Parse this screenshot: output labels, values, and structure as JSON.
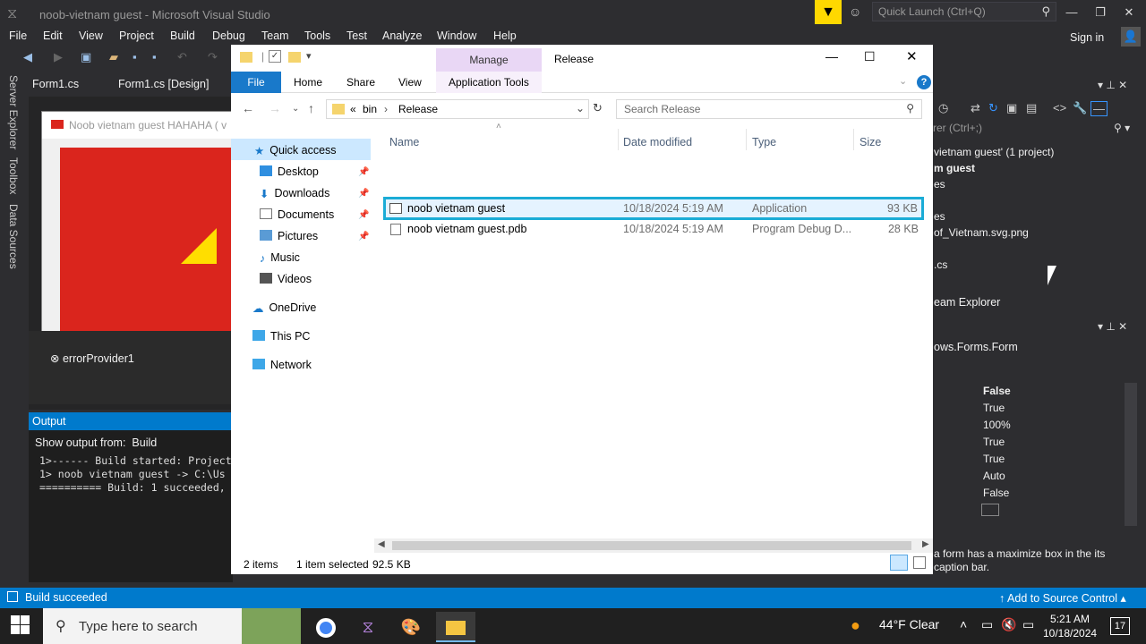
{
  "vs": {
    "title": "noob-vietnam guest - Microsoft Visual Studio",
    "quick_launch_placeholder": "Quick Launch (Ctrl+Q)",
    "menu": [
      "File",
      "Edit",
      "View",
      "Project",
      "Build",
      "Debug",
      "Team",
      "Tools",
      "Test",
      "Analyze",
      "Window",
      "Help"
    ],
    "sign_in": "Sign in",
    "side_tabs": [
      "Server Explorer",
      "Toolbox",
      "Data Sources"
    ],
    "doc_tabs": [
      "Form1.cs",
      "Form1.cs [Design]"
    ],
    "form_title": "Noob vietnam guest HAHAHA ( v",
    "component_tray_item": "errorProvider1",
    "output": {
      "header": "Output",
      "show_from_label": "Show output from:",
      "show_from_value": "Build",
      "lines": [
        "1>------ Build started: Project",
        "1>  noob vietnam guest -> C:\\Us",
        "========== Build: 1 succeeded,"
      ]
    },
    "solution_explorer": {
      "search_placeholder": "rer (Ctrl+;)",
      "lines": [
        "vietnam guest' (1 project)",
        "m guest",
        "es",
        "es",
        "of_Vietnam.svg.png",
        ".cs"
      ]
    },
    "team_explorer": "eam Explorer",
    "properties": {
      "type": "ows.Forms.Form",
      "values": [
        "False",
        "True",
        "100%",
        "True",
        "True",
        "Auto",
        "False"
      ],
      "description": "a form has a maximize box in the its caption bar."
    },
    "status": "Build succeeded",
    "add_source_control": "Add to Source Control"
  },
  "explorer": {
    "title": "Release",
    "manage_tab": "Manage",
    "ribbon_tabs": [
      "File",
      "Home",
      "Share",
      "View",
      "Application Tools"
    ],
    "address": {
      "prefix": "«",
      "segments": [
        "bin",
        "Release"
      ]
    },
    "search_placeholder": "Search Release",
    "nav": [
      {
        "label": "Quick access",
        "icon": "star-icon",
        "pinned": false
      },
      {
        "label": "Desktop",
        "icon": "desktop-icon",
        "pinned": true
      },
      {
        "label": "Downloads",
        "icon": "downloads-icon",
        "pinned": true
      },
      {
        "label": "Documents",
        "icon": "documents-icon",
        "pinned": true
      },
      {
        "label": "Pictures",
        "icon": "pictures-icon",
        "pinned": true
      },
      {
        "label": "Music",
        "icon": "music-icon",
        "pinned": false
      },
      {
        "label": "Videos",
        "icon": "videos-icon",
        "pinned": false
      },
      {
        "label": "OneDrive",
        "icon": "cloud-icon",
        "pinned": false
      },
      {
        "label": "This PC",
        "icon": "computer-icon",
        "pinned": false
      },
      {
        "label": "Network",
        "icon": "network-icon",
        "pinned": false
      }
    ],
    "columns": [
      "Name",
      "Date modified",
      "Type",
      "Size"
    ],
    "files": [
      {
        "name": "noob vietnam guest",
        "date": "10/18/2024 5:19 AM",
        "type": "Application",
        "size": "93 KB"
      },
      {
        "name": "noob vietnam guest.pdb",
        "date": "10/18/2024 5:19 AM",
        "type": "Program Debug D...",
        "size": "28 KB"
      }
    ],
    "status": {
      "items": "2 items",
      "selected": "1 item selected",
      "size": "92.5 KB"
    }
  },
  "taskbar": {
    "search_placeholder": "Type here to search",
    "weather": "44°F  Clear",
    "time": "5:21 AM",
    "date": "10/18/2024",
    "notification_count": "17"
  },
  "colors": {
    "vs_accent": "#007acc",
    "selection_border": "#1bacd6",
    "manage_tab": "#e9d7f5",
    "file_tab": "#1979ca"
  }
}
